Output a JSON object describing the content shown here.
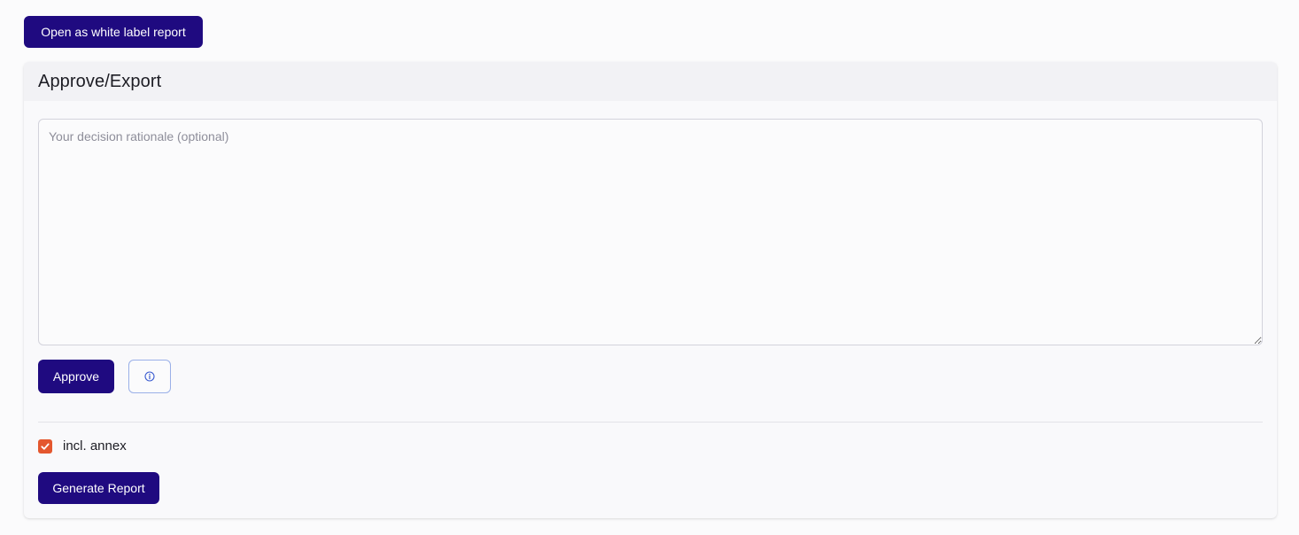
{
  "toolbar": {
    "white_label_label": "Open as white label report"
  },
  "card": {
    "title": "Approve/Export",
    "rationale_placeholder": "Your decision rationale (optional)",
    "rationale_value": "",
    "approve_label": "Approve",
    "info_icon": "info-circle-icon",
    "annex_checkbox": {
      "label": "incl. annex",
      "checked": true
    },
    "generate_label": "Generate Report"
  },
  "colors": {
    "primary": "#1f0a80",
    "checkbox_accent": "#e4572e",
    "info_border": "#9ab0e8",
    "info_icon": "#3a5bd0"
  }
}
